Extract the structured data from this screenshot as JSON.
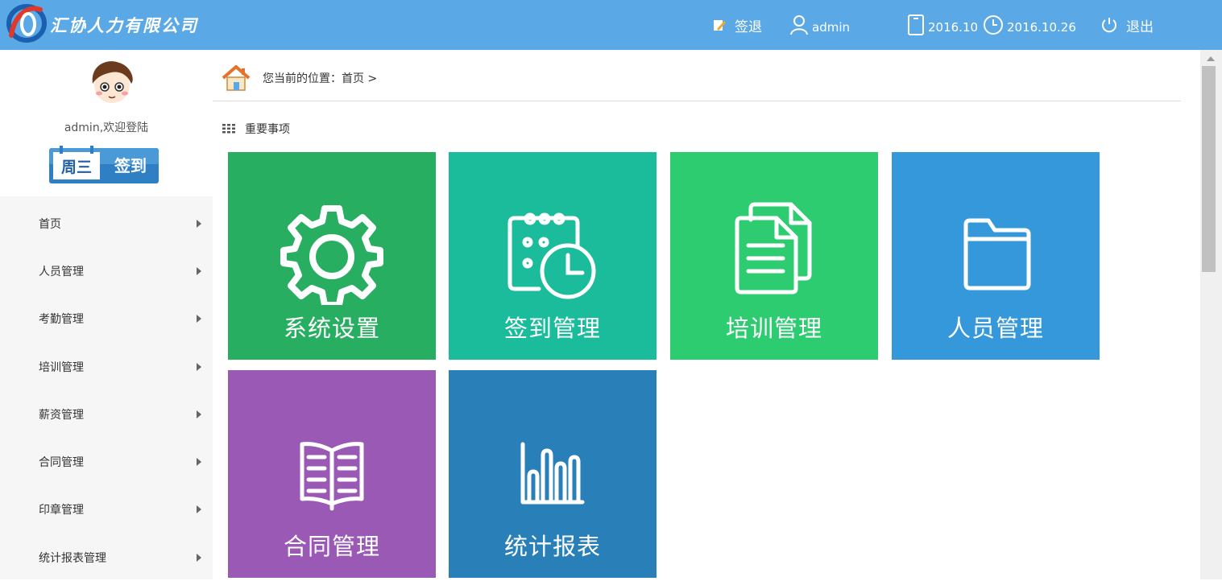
{
  "header": {
    "company_name": "汇协人力有限公司",
    "sign_out_label": "签退",
    "username": "admin",
    "month": "2016.10",
    "date": "2016.10.26",
    "logout_label": "退出",
    "bg_color": "#5aa9e6"
  },
  "sidebar": {
    "welcome": "admin,欢迎登陆",
    "signin": {
      "weekday": "周三",
      "label": "签到"
    },
    "items": [
      {
        "label": "首页"
      },
      {
        "label": "人员管理"
      },
      {
        "label": "考勤管理"
      },
      {
        "label": "培训管理"
      },
      {
        "label": "薪资管理"
      },
      {
        "label": "合同管理"
      },
      {
        "label": "印章管理"
      },
      {
        "label": "统计报表管理"
      }
    ]
  },
  "main": {
    "breadcrumb": "您当前的位置：首页 >",
    "section_title": "重要事项",
    "tiles": [
      {
        "label": "系统设置",
        "icon": "gear-icon",
        "color": "#27ae60"
      },
      {
        "label": "签到管理",
        "icon": "calendar-clock-icon",
        "color": "#1abc9c"
      },
      {
        "label": "培训管理",
        "icon": "documents-icon",
        "color": "#2ecc71"
      },
      {
        "label": "人员管理",
        "icon": "folder-icon",
        "color": "#3498db"
      },
      {
        "label": "合同管理",
        "icon": "book-icon",
        "color": "#9b59b6"
      },
      {
        "label": "统计报表",
        "icon": "bar-chart-icon",
        "color": "#2980b9"
      }
    ]
  }
}
